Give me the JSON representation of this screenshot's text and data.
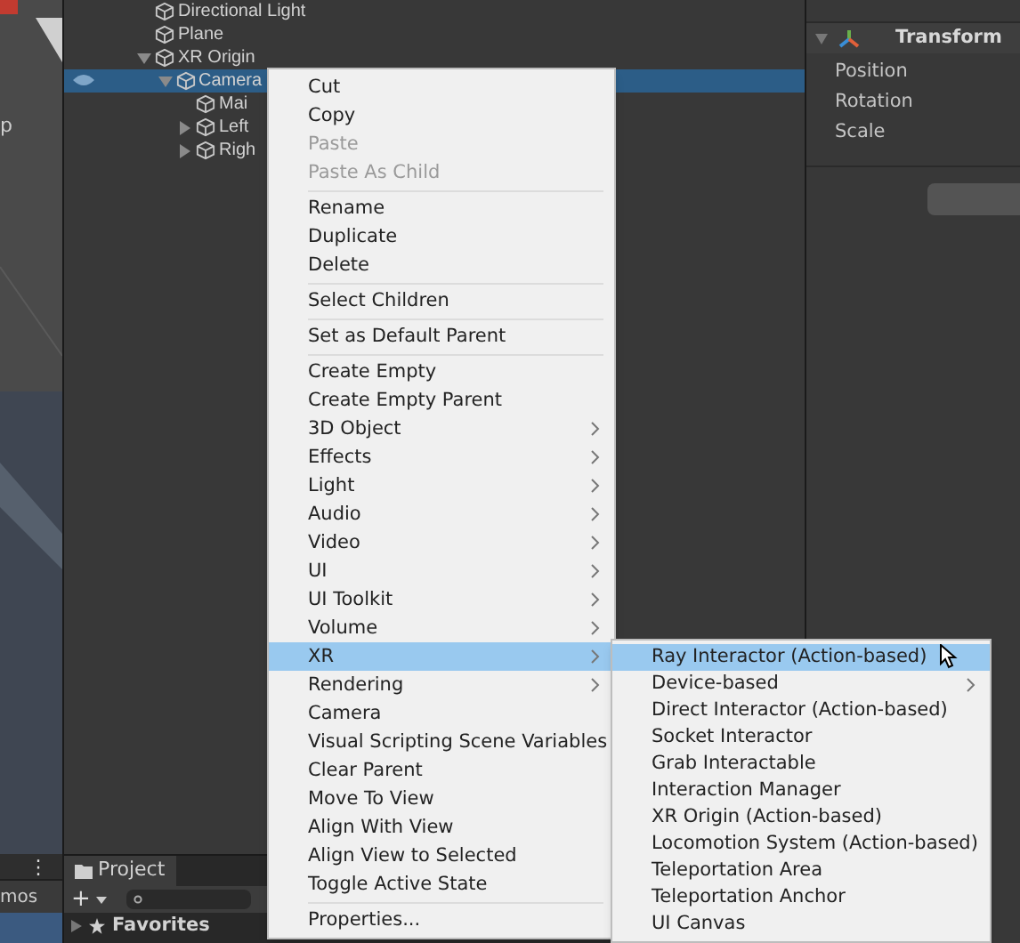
{
  "hierarchy": {
    "rows": [
      {
        "label": "Directional Light",
        "selected": false
      },
      {
        "label": "Plane",
        "selected": false
      },
      {
        "label": "XR Origin",
        "expanded": true,
        "selected": false,
        "children": [
          {
            "label": "Camera",
            "expanded": true,
            "selected": true,
            "children": [
              {
                "label": "Mai",
                "selected": false
              },
              {
                "label": "Left",
                "expanded": false,
                "selected": false
              },
              {
                "label": "Righ",
                "expanded": false,
                "selected": false
              }
            ]
          }
        ]
      }
    ]
  },
  "scene_view": {
    "label": "p",
    "toolbar_label": "mos",
    "menu_glyph": "⋮"
  },
  "inspector": {
    "component": {
      "title": "Transform",
      "expanded": true,
      "fields": [
        "Position",
        "Rotation",
        "Scale"
      ]
    }
  },
  "project_panel": {
    "tab": "Project",
    "add_glyph": "+",
    "favorites": "Favorites"
  },
  "context_menu": {
    "items": [
      {
        "kind": "item",
        "label": "Cut",
        "disabled": false,
        "submenu": false,
        "selected": false
      },
      {
        "kind": "item",
        "label": "Copy",
        "disabled": false,
        "submenu": false,
        "selected": false
      },
      {
        "kind": "item",
        "label": "Paste",
        "disabled": true,
        "submenu": false,
        "selected": false
      },
      {
        "kind": "item",
        "label": "Paste As Child",
        "disabled": true,
        "submenu": false,
        "selected": false
      },
      {
        "kind": "separator"
      },
      {
        "kind": "item",
        "label": "Rename",
        "disabled": false,
        "submenu": false,
        "selected": false
      },
      {
        "kind": "item",
        "label": "Duplicate",
        "disabled": false,
        "submenu": false,
        "selected": false
      },
      {
        "kind": "item",
        "label": "Delete",
        "disabled": false,
        "submenu": false,
        "selected": false
      },
      {
        "kind": "separator"
      },
      {
        "kind": "item",
        "label": "Select Children",
        "disabled": false,
        "submenu": false,
        "selected": false
      },
      {
        "kind": "separator"
      },
      {
        "kind": "item",
        "label": "Set as Default Parent",
        "disabled": false,
        "submenu": false,
        "selected": false
      },
      {
        "kind": "separator"
      },
      {
        "kind": "item",
        "label": "Create Empty",
        "disabled": false,
        "submenu": false,
        "selected": false
      },
      {
        "kind": "item",
        "label": "Create Empty Parent",
        "disabled": false,
        "submenu": false,
        "selected": false
      },
      {
        "kind": "item",
        "label": "3D Object",
        "disabled": false,
        "submenu": true,
        "selected": false
      },
      {
        "kind": "item",
        "label": "Effects",
        "disabled": false,
        "submenu": true,
        "selected": false
      },
      {
        "kind": "item",
        "label": "Light",
        "disabled": false,
        "submenu": true,
        "selected": false
      },
      {
        "kind": "item",
        "label": "Audio",
        "disabled": false,
        "submenu": true,
        "selected": false
      },
      {
        "kind": "item",
        "label": "Video",
        "disabled": false,
        "submenu": true,
        "selected": false
      },
      {
        "kind": "item",
        "label": "UI",
        "disabled": false,
        "submenu": true,
        "selected": false
      },
      {
        "kind": "item",
        "label": "UI Toolkit",
        "disabled": false,
        "submenu": true,
        "selected": false
      },
      {
        "kind": "item",
        "label": "Volume",
        "disabled": false,
        "submenu": true,
        "selected": false
      },
      {
        "kind": "item",
        "label": "XR",
        "disabled": false,
        "submenu": true,
        "selected": true
      },
      {
        "kind": "item",
        "label": "Rendering",
        "disabled": false,
        "submenu": true,
        "selected": false
      },
      {
        "kind": "item",
        "label": "Camera",
        "disabled": false,
        "submenu": false,
        "selected": false
      },
      {
        "kind": "item",
        "label": "Visual Scripting Scene Variables",
        "disabled": false,
        "submenu": false,
        "selected": false
      },
      {
        "kind": "item",
        "label": "Clear Parent",
        "disabled": false,
        "submenu": false,
        "selected": false
      },
      {
        "kind": "item",
        "label": "Move To View",
        "disabled": false,
        "submenu": false,
        "selected": false
      },
      {
        "kind": "item",
        "label": "Align With View",
        "disabled": false,
        "submenu": false,
        "selected": false
      },
      {
        "kind": "item",
        "label": "Align View to Selected",
        "disabled": false,
        "submenu": false,
        "selected": false
      },
      {
        "kind": "item",
        "label": "Toggle Active State",
        "disabled": false,
        "submenu": false,
        "selected": false
      },
      {
        "kind": "separator"
      },
      {
        "kind": "item",
        "label": "Properties...",
        "disabled": false,
        "submenu": false,
        "selected": false
      }
    ]
  },
  "xr_submenu": {
    "items": [
      {
        "kind": "item",
        "label": "Ray Interactor (Action-based)",
        "submenu": false,
        "selected": true
      },
      {
        "kind": "item",
        "label": "Device-based",
        "submenu": true,
        "selected": false
      },
      {
        "kind": "item",
        "label": "Direct Interactor (Action-based)",
        "submenu": false,
        "selected": false
      },
      {
        "kind": "item",
        "label": "Socket Interactor",
        "submenu": false,
        "selected": false
      },
      {
        "kind": "item",
        "label": "Grab Interactable",
        "submenu": false,
        "selected": false
      },
      {
        "kind": "item",
        "label": "Interaction Manager",
        "submenu": false,
        "selected": false
      },
      {
        "kind": "item",
        "label": "XR Origin (Action-based)",
        "submenu": false,
        "selected": false
      },
      {
        "kind": "item",
        "label": "Locomotion System (Action-based)",
        "submenu": false,
        "selected": false
      },
      {
        "kind": "item",
        "label": "Teleportation Area",
        "submenu": false,
        "selected": false
      },
      {
        "kind": "item",
        "label": "Teleportation Anchor",
        "submenu": false,
        "selected": false
      },
      {
        "kind": "item",
        "label": "UI Canvas",
        "submenu": false,
        "selected": false
      }
    ]
  }
}
